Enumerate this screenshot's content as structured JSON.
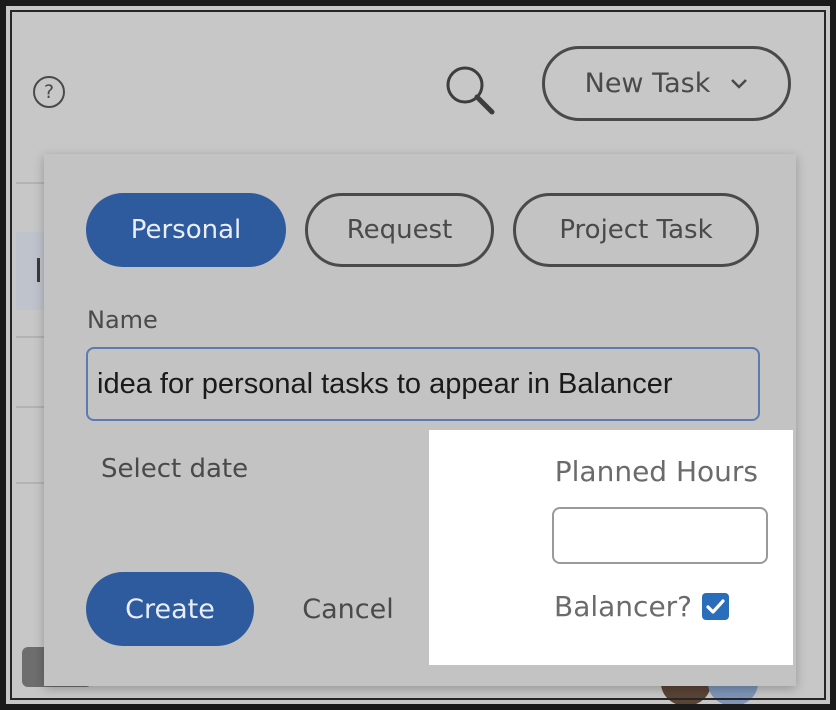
{
  "header": {
    "help_icon_glyph": "?",
    "new_task_label": "New Task"
  },
  "modal": {
    "tabs": [
      {
        "label": "Personal",
        "selected": true
      },
      {
        "label": "Request",
        "selected": false
      },
      {
        "label": "Project Task",
        "selected": false
      }
    ],
    "name_label": "Name",
    "name_value": "idea for personal tasks to appear in Balancer",
    "select_date_label": "Select date",
    "planned_hours_label": "Planned Hours",
    "planned_hours_value": "",
    "balancer_label": "Balancer?",
    "balancer_checked": true,
    "create_label": "Create",
    "cancel_label": "Cancel"
  },
  "colors": {
    "accent": "#2e5a9e",
    "checkbox": "#2a6ebb",
    "overlay": "#c3c3c3"
  },
  "icons": [
    "help-icon",
    "search-icon",
    "chevron-down-icon",
    "checkmark-icon"
  ]
}
